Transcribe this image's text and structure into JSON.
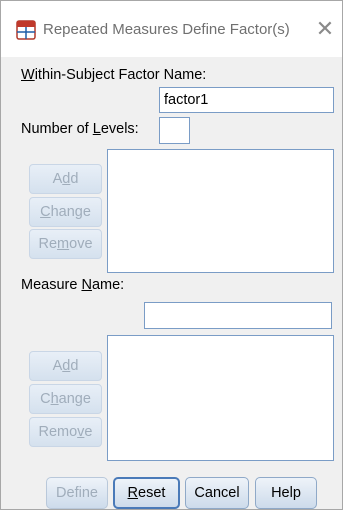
{
  "window": {
    "title": "Repeated Measures Define Factor(s)",
    "close_glyph": "✕"
  },
  "factor": {
    "name_label_u": "W",
    "name_label_rest": "ithin-Subject Factor Name:",
    "name_value": "factor1",
    "levels_label_pre": "Number of ",
    "levels_label_u": "L",
    "levels_label_post": "evels:",
    "levels_value": "",
    "buttons": {
      "add_pre": "A",
      "add_u": "d",
      "add_post": "d",
      "change_pre": "",
      "change_u": "C",
      "change_post": "hange",
      "remove_pre": "Re",
      "remove_u": "m",
      "remove_post": "ove"
    }
  },
  "measure": {
    "label_pre": "Measure ",
    "label_u": "N",
    "label_post": "ame:",
    "value": "",
    "buttons": {
      "add_pre": "A",
      "add_u": "d",
      "add_post": "d",
      "change_pre": "C",
      "change_u": "h",
      "change_post": "ange",
      "remove_pre": "Remo",
      "remove_u": "v",
      "remove_post": "e"
    }
  },
  "footer": {
    "define": "Define",
    "reset_u": "R",
    "reset_post": "eset",
    "cancel": "Cancel",
    "help": "Help"
  },
  "colors": {
    "accent_border": "#4a7ab8",
    "disabled_text": "#a0adbb",
    "field_border": "#7a9cc6"
  }
}
